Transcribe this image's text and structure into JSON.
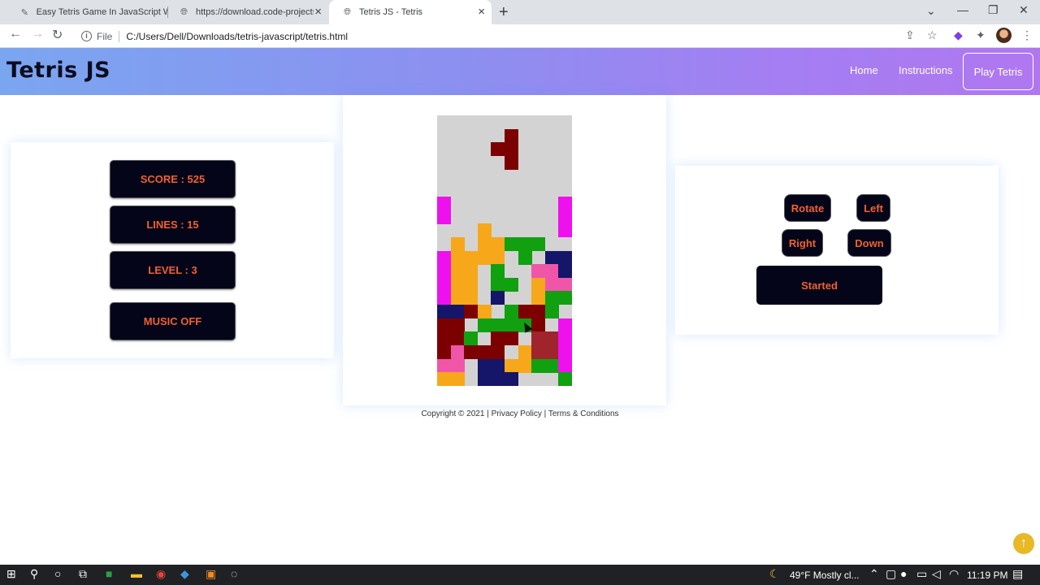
{
  "browser": {
    "tabs": [
      {
        "title": "Easy Tetris Game In JavaScript W",
        "icon": "feather-icon",
        "active": false
      },
      {
        "title": "https://download.code-projects.o",
        "icon": "globe-icon",
        "active": false
      },
      {
        "title": "Tetris JS - Tetris",
        "icon": "globe-icon",
        "active": true
      }
    ],
    "address_scheme": "File",
    "address_url": "C:/Users/Dell/Downloads/tetris-javascript/tetris.html"
  },
  "header": {
    "logo": "Tetris JS",
    "nav": [
      "Home",
      "Instructions"
    ],
    "play_button": "Play Tetris"
  },
  "stats": {
    "score": "SCORE : 525",
    "lines": "LINES : 15",
    "level": "LEVEL : 3",
    "music": "MUSIC OFF"
  },
  "controls": {
    "rotate": "Rotate",
    "left": "Left",
    "right": "Right",
    "down": "Down",
    "start": "Started"
  },
  "board": {
    "columns": 10,
    "rows": 20,
    "empty_color": "#d3d3d3",
    "palette": {
      "O": "#f6a81a",
      "G": "#10a010",
      "M": "#ee11ee",
      "P": "#f056a8",
      "N": "#15156a",
      "R": "#7d0000",
      "C": "#a0242c"
    },
    "rows_data": [
      "..........",
      ".....R....",
      "....RR....",
      ".....R....",
      "..........",
      "..........",
      "*........M",
      "*........M",
      "...O.....M",
      ".O.OOGGG..",
      "MOOOO.G.NN",
      "MOO.G..PPN",
      "MOO.GG.OPP",
      "MOO.N..OGG",
      "NNRO.GRRG.",
      "RR.GGGGR.M",
      "RRG.RR.CCM",
      "RPRRR.OCCM",
      "PP.NNOOGGM",
      "OO.NNN...G"
    ]
  },
  "footer": {
    "copyright": "Copyright © 2021 |",
    "privacy": "Privacy Policy",
    "separator": "|",
    "terms": "Terms & Conditions"
  },
  "taskbar": {
    "weather": "49°F  Mostly cl...",
    "time": "11:19 PM"
  }
}
